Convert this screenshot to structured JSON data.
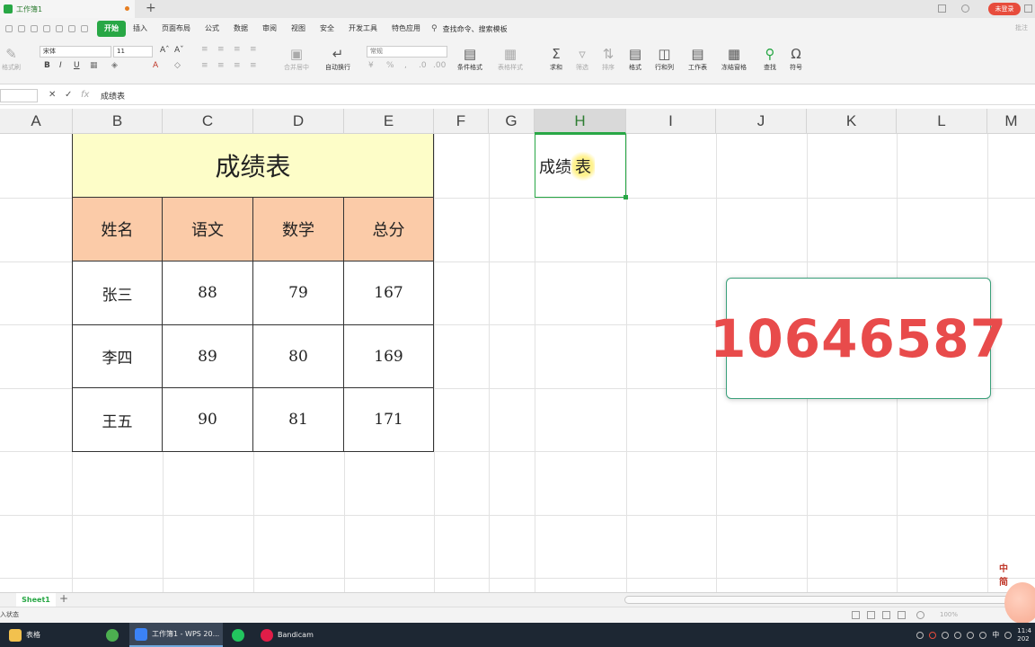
{
  "titlebar": {
    "doc_tab": "工作簿1",
    "new_tab": "+",
    "login_badge": "未登录"
  },
  "menu": {
    "items": [
      "开始",
      "插入",
      "页面布局",
      "公式",
      "数据",
      "审阅",
      "视图",
      "安全",
      "开发工具",
      "特色应用"
    ],
    "active": "开始",
    "search": "查找命令、搜索模板",
    "right_notify": "批注"
  },
  "ribbon": {
    "font_name": "宋体",
    "font_size": "11",
    "number_format": "常规",
    "format_painter": "格式刷",
    "merge_center": "合并居中",
    "wrap_text": "自动换行",
    "conditional_format": "条件格式",
    "table_style": "表格样式",
    "sum": "求和",
    "filter": "筛选",
    "sort": "排序",
    "format": "格式",
    "row_col": "行和列",
    "worksheet": "工作表",
    "freeze": "冻结窗格",
    "find": "查找",
    "symbol": "符号",
    "bold": "B",
    "italic": "I",
    "underline": "U",
    "font_color": "A"
  },
  "formula_bar": {
    "fx": "fx",
    "content": "成绩表"
  },
  "columns": [
    "A",
    "B",
    "C",
    "D",
    "E",
    "F",
    "G",
    "H",
    "I",
    "J",
    "K",
    "L",
    "M"
  ],
  "selected_column": "H",
  "table": {
    "title": "成绩表",
    "headers": [
      "姓名",
      "语文",
      "数学",
      "总分"
    ],
    "rows": [
      [
        "张三",
        "88",
        "79",
        "167"
      ],
      [
        "李四",
        "89",
        "80",
        "169"
      ],
      [
        "王五",
        "90",
        "81",
        "171"
      ]
    ]
  },
  "h_cell": {
    "prefix": "成绩",
    "highlight": "表"
  },
  "overlay_number": "10646587",
  "sheet_tab": "Sheet1",
  "status_text": "入状态",
  "zoom": "100%",
  "taskbar": {
    "items": [
      "表格",
      "工作簿1 - WPS 20...",
      "Bandicam"
    ],
    "ime": "中",
    "time": "11:4",
    "date": "202"
  },
  "watermark": "中 简 "
}
